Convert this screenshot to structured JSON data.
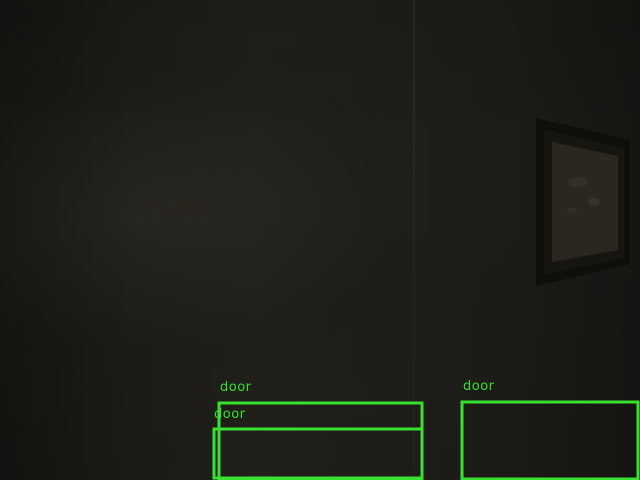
{
  "scene": {
    "wall_color": "#1d1c17",
    "box_color": "#38e02f"
  },
  "detections": [
    {
      "label": "door"
    },
    {
      "label": "door"
    },
    {
      "label": "door"
    }
  ]
}
